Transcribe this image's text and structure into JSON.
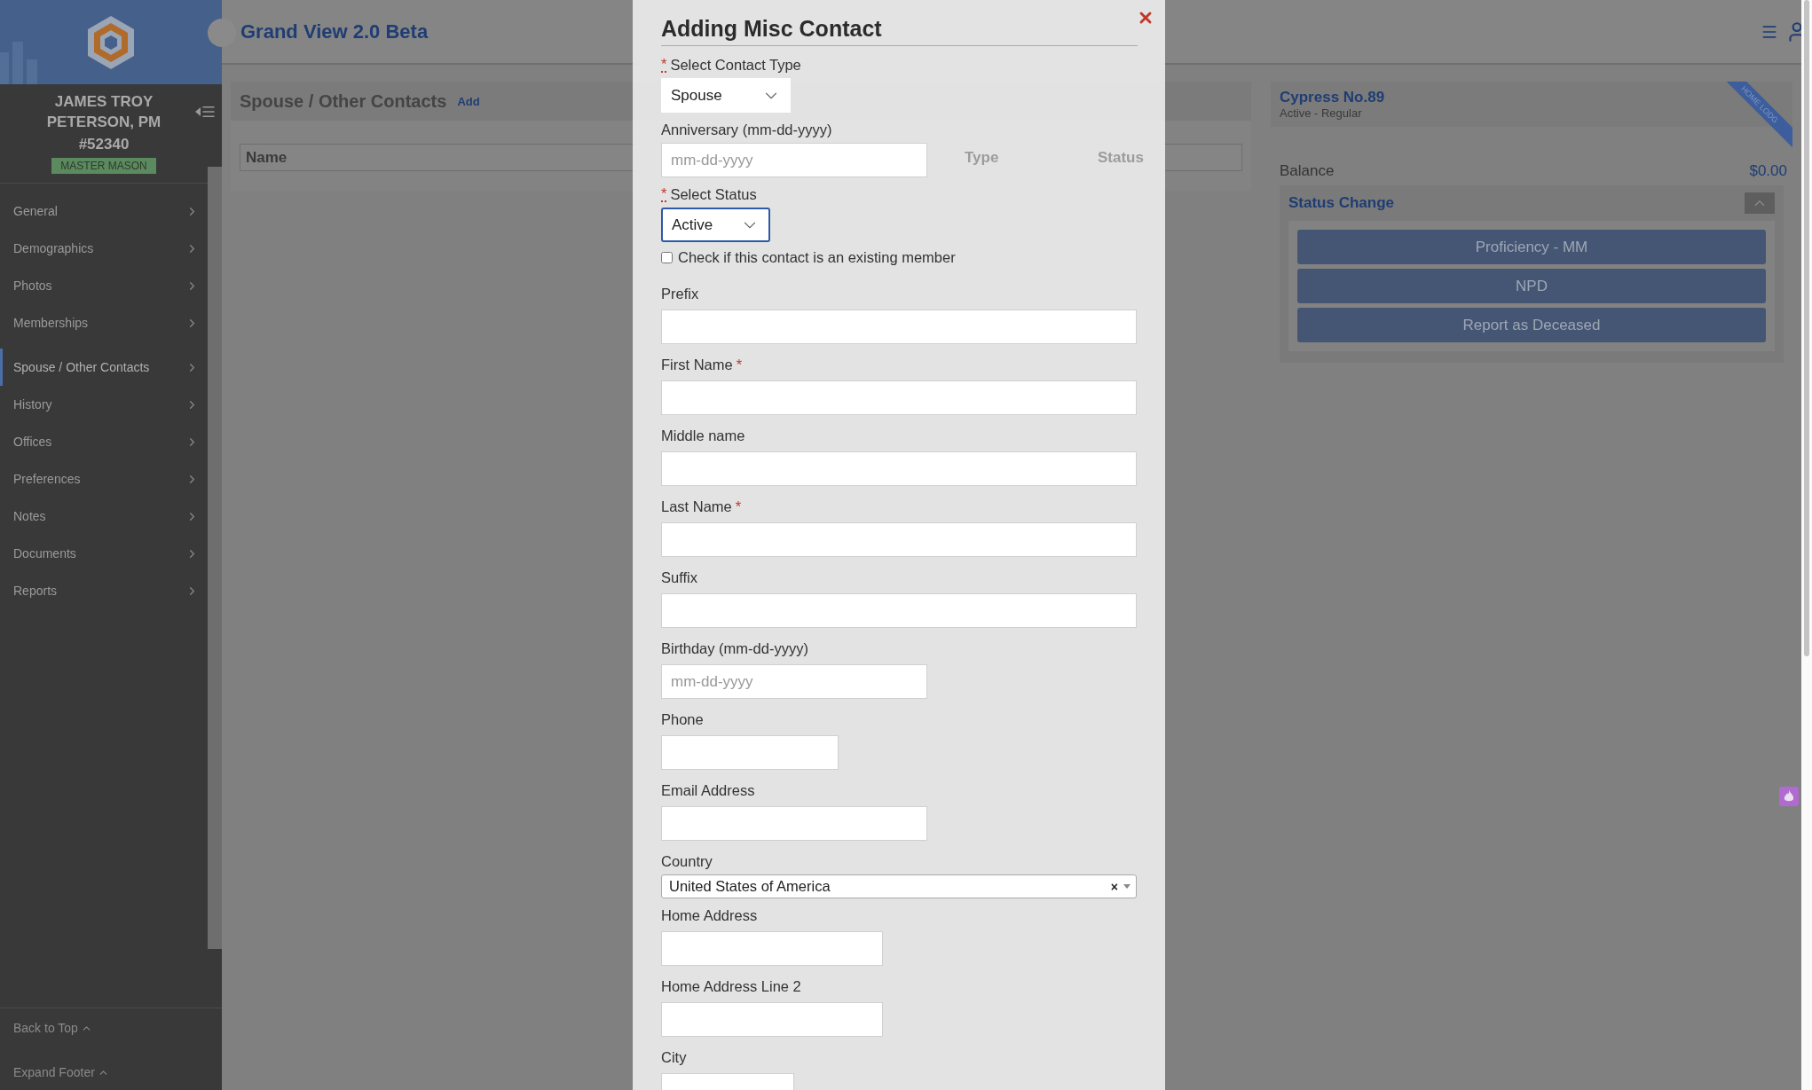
{
  "sidebar": {
    "user": {
      "name": "JAMES TROY PETERSON, PM",
      "number": "#52340",
      "rank": "MASTER MASON"
    },
    "items": [
      {
        "label": "General",
        "selected": false
      },
      {
        "label": "Demographics",
        "selected": false
      },
      {
        "label": "Photos",
        "selected": false
      },
      {
        "label": "Memberships",
        "selected": false
      },
      {
        "label": "Spouse / Other Contacts",
        "selected": true
      },
      {
        "label": "History",
        "selected": false
      },
      {
        "label": "Offices",
        "selected": false
      },
      {
        "label": "Preferences",
        "selected": false
      },
      {
        "label": "Notes",
        "selected": false
      },
      {
        "label": "Documents",
        "selected": false
      },
      {
        "label": "Reports",
        "selected": false
      }
    ],
    "footer": [
      "Back to Top",
      "Expand Footer"
    ]
  },
  "header": {
    "title": "Grand View 2.0 Beta"
  },
  "contacts_card": {
    "title": "Spouse / Other Contacts",
    "add_link": "Add",
    "columns": [
      "Name",
      "Type",
      "Status"
    ]
  },
  "lodge_card": {
    "title": "Cypress No.89",
    "subtitle": "Active  - Regular",
    "ribbon": "HOME LODG",
    "balance_label": "Balance",
    "balance": "$0.00",
    "section_title": "Status Change",
    "expanded": true,
    "actions": [
      "Proficiency - MM",
      "NPD",
      "Report as Deceased"
    ]
  },
  "modal": {
    "title": "Adding Misc Contact",
    "fields": [
      {
        "kind": "select",
        "label": "Select Contact Type",
        "mark_before": "*",
        "value": "Spouse",
        "focused": false
      },
      {
        "kind": "date",
        "label": "Anniversary (mm-dd-yyyy)",
        "placeholder": "mm-dd-yyyy"
      },
      {
        "kind": "select",
        "label": "Select Status",
        "mark_before": "*",
        "value": "Active",
        "focused": true
      },
      {
        "kind": "checkbox",
        "label": "Check if this contact is an existing member",
        "checked": false
      },
      {
        "kind": "text",
        "label": "Prefix"
      },
      {
        "kind": "text",
        "label": "First Name",
        "mark_after": "*"
      },
      {
        "kind": "text",
        "label": "Middle name"
      },
      {
        "kind": "text",
        "label": "Last Name",
        "mark_after": "*"
      },
      {
        "kind": "text",
        "label": "Suffix"
      },
      {
        "kind": "date",
        "label": "Birthday (mm-dd-yyyy)",
        "placeholder": "mm-dd-yyyy"
      },
      {
        "kind": "text",
        "label": "Phone"
      },
      {
        "kind": "text",
        "label": "Email Address"
      },
      {
        "kind": "combo",
        "label": "Country",
        "value": "United States of America",
        "clear": "×"
      },
      {
        "kind": "text",
        "label": "Home Address"
      },
      {
        "kind": "text",
        "label": "Home Address Line 2"
      },
      {
        "kind": "text",
        "label": "City"
      }
    ]
  }
}
